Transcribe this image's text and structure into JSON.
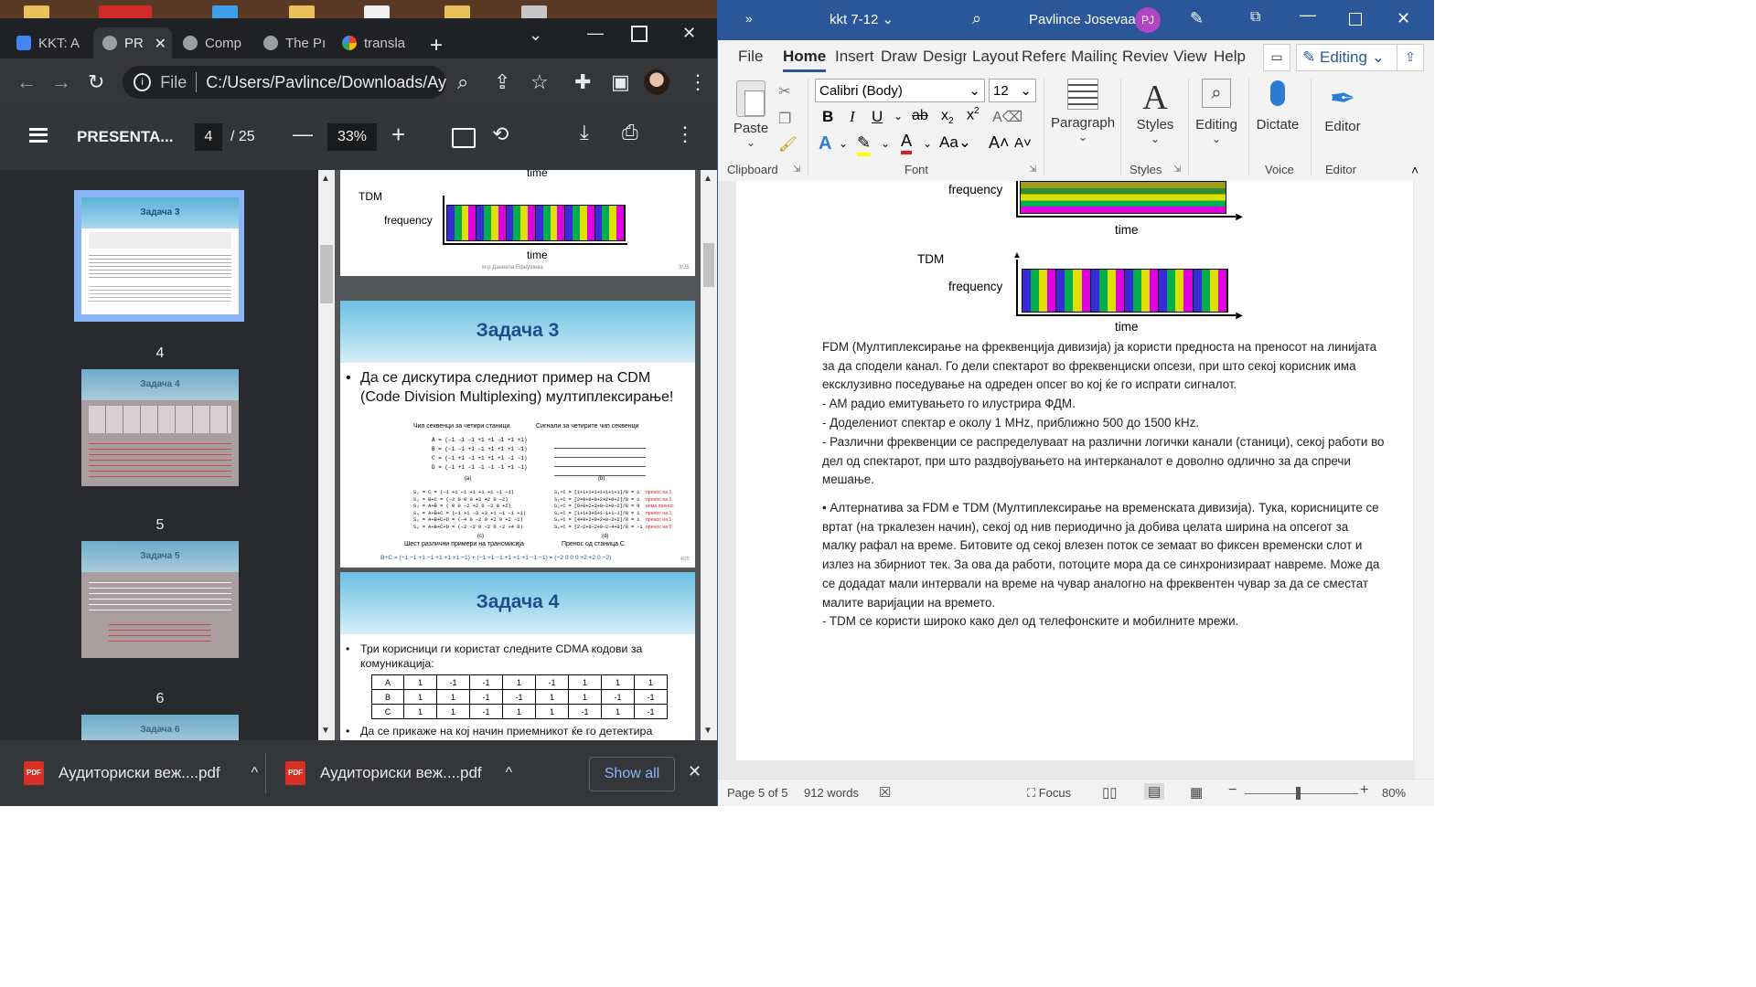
{
  "chrome": {
    "tabs": [
      {
        "label": "KKT: A",
        "active": false
      },
      {
        "label": "PR",
        "active": true
      },
      {
        "label": "Comp",
        "active": false
      },
      {
        "label": "The Pı",
        "active": false
      },
      {
        "label": "transla",
        "active": false
      }
    ],
    "new_tab": "+",
    "address": {
      "scheme": "File",
      "url": "C:/Users/Pavlince/Downloads/Ay..."
    },
    "pdf": {
      "title": "PRESENTA...",
      "page": "4",
      "total": "/ 25",
      "zoom": "33%"
    },
    "thumbnails": [
      {
        "num": "4",
        "title": "Задача 3"
      },
      {
        "num": "5",
        "title": "Задача 4"
      },
      {
        "num": "6",
        "title": "Задача 5"
      },
      {
        "title": "Задача 6"
      }
    ],
    "slides": {
      "prev": {
        "time_top": "time",
        "label": "TDM",
        "freq": "frequency",
        "time": "time",
        "footer": "м-р Даниела Ефнушева",
        "pageno": "3/25"
      },
      "s3": {
        "title": "Задача 3",
        "bullet": "Да се дискутира следниот пример на CDM (Code Division Multiplexing) мултиплексирање!",
        "cap_a": "Чип секвенци за четири станици",
        "cap_b": "Сигнали за четирите чип секвенци",
        "seqs": [
          "A = (−1 −1 −1 +1 +1 −1 +1 +1)",
          "B = (−1 −1 +1 −1 +1 +1 +1 −1)",
          "C = (−1 +1 −1 +1 +1 +1 −1 −1)",
          "D = (−1 +1 −1 −1 −1 −1 +1 −1)"
        ],
        "lbl_a": "(a)",
        "lbl_b": "(b)",
        "lbl_c": "(c)",
        "lbl_d": "(d)",
        "sums": [
          "S₁ = C        = (−1 +1 −1 +1 +1 +1 −1 −1)",
          "S₂ = B+C     = (−2  0  0  0 +2 +2  0 −2)",
          "S₃ = A+B̄     = ( 0  0 −2 +2  0 −2  0 +2)",
          "S₄ = A+B̄+C   = (−1 +1 −3 +3 +1 −1 −1 +1)",
          "S₅ = A+B+C+D = (−4  0 −2  0 +2  0 +2 −2)",
          "S₆ = A+B+C̄+D = (−2 −2  0 −2  0 −2 +4  0)"
        ],
        "dots": [
          "S₁•C = [1+1+1+1+1+1+1+1]/8 = 1",
          "S₂•C = [2+0+0+0+2+2+0+2]/8 = 1",
          "S₃•C = [0+0+2+2+0−2+0−2]/8 = 0",
          "S₄•C = [1+1+3+3+1−1+1−1]/8 = 1",
          "S₅•C = [4+0+2+0+2+0−2+2]/8 = 1",
          "S₆•C = [2−2+0−2+0−2−4+0]/8 = −1"
        ],
        "notes": [
          "пренос на 1",
          "пренос на 1",
          "нема пренос",
          "пренос на 1",
          "пренос на 1",
          "пренос на 0"
        ],
        "cap_c": "Шест различни примери на трансмисија",
        "cap_d": "Пренос од станица C",
        "formula": "B+C =  (−1 −1 +1 −1 +1 +1 +1 −1) + (−1 +1 −1 +1 +1 +1 −1 −1) = (−2  0  0  0 +2 +2  0 −2)",
        "pageno": "4/25"
      },
      "s4": {
        "title": "Задача 4",
        "bullet1": "Три корисници ги користат следните CDMA кодови за комуникација:",
        "rows": [
          {
            "name": "A",
            "vals": [
              "1",
              "-1",
              "-1",
              "1",
              "-1",
              "1",
              "1",
              "1"
            ]
          },
          {
            "name": "B",
            "vals": [
              "1",
              "1",
              "-1",
              "-1",
              "1",
              "1",
              "-1",
              "-1"
            ]
          },
          {
            "name": "C",
            "vals": [
              "1",
              "1",
              "-1",
              "1",
              "1",
              "-1",
              "1",
              "-1"
            ]
          }
        ],
        "bullet2": "Да се прикаже на кој начин приемникот ќе го детектира испратениот сигнал (B+C) доколку ја знае чип секвенцата на А, В и С."
      }
    },
    "downloads": [
      {
        "name": "Аудиториски веж....pdf"
      },
      {
        "name": "Аудиториски веж....pdf"
      }
    ],
    "show_all": "Show all"
  },
  "word": {
    "doc_title": "kkt 7-12",
    "user": "Pavlince Josevaa",
    "initials": "PJ",
    "menu": [
      "File",
      "Home",
      "Insert",
      "Draw",
      "Design",
      "Layout",
      "References",
      "Mailings",
      "Review",
      "View",
      "Help"
    ],
    "active_tab": "Home",
    "editing_mode": "Editing",
    "ribbon": {
      "paste": "Paste",
      "clipboard": "Clipboard",
      "font_name": "Calibri (Body)",
      "font_size": "12",
      "font": "Font",
      "paragraph": "Paragraph",
      "styles": "Styles",
      "styles_group": "Styles",
      "editing": "Editing",
      "dictate": "Dictate",
      "voice": "Voice",
      "editor": "Editor",
      "editor_group": "Editor"
    },
    "figure": {
      "freq_top": "frequency",
      "time_top": "time",
      "tdm": "TDM",
      "freq": "frequency",
      "time": "time"
    },
    "paragraphs": [
      "FDM (Мултиплексирање на фреквенција дивизија) ја користи предноста на преносот на линијата за да сподели канал. Го дели спектарот во фреквенциски опсези, при што секој корисник има ексклузивно поседување на одреден опсег во кој ќе го испрати сигналот.",
      "- AM радио емитувањето го илустрира ФДМ.",
      "- Доделениот спектар е околу 1 MHz, приближно 500 до 1500 kHz.",
      "- Различни фреквенции се распределуваат на различни логички канали (станици), секој работи во дел од спектарот, при што раздвојувањето на интерканалот е доволно одлично за да спречи мешање.",
      "• Алтернатива за FDM е TDM (Мултиплексирање на временската дивизија). Тука, корисниците се вртат (на тркалезен начин), секој од нив периодично ја добива целата ширина на опсегот за малку рафал на време. Битовите од секој влезен поток се земаат во фиксен временски слот и излез на збирниот тек. За ова да работи, потоците мора да се синхронизираат навреме. Може да се додадат мали интервали на време на чувар аналогно на фреквентен чувар за да се сместат малите варијации на времето.",
      "- TDM се користи широко како дел од телефонските и мобилните мрежи."
    ],
    "status": {
      "page": "Page 5 of 5",
      "words": "912 words",
      "focus": "Focus",
      "zoom": "80%"
    }
  },
  "colors": {
    "word_blue": "#2b579a",
    "chrome_dark": "#202124",
    "chrome_tab": "#35363a"
  }
}
